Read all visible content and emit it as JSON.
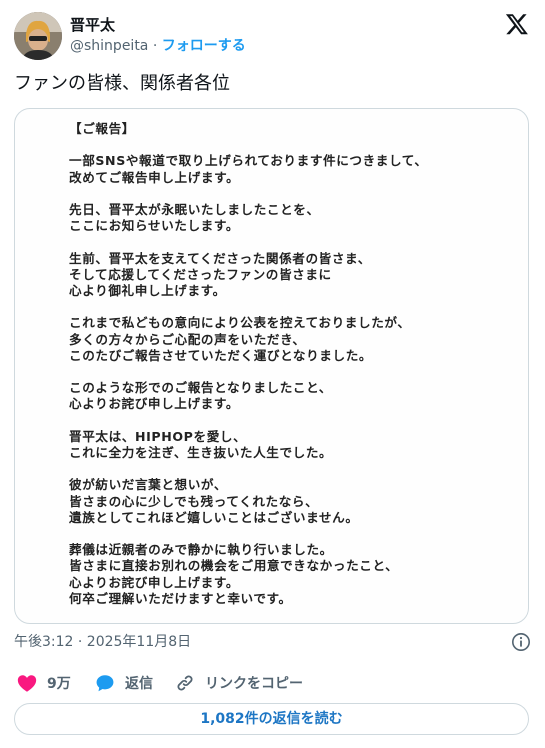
{
  "author": {
    "display_name": "晋平太",
    "handle": "@shinpeita",
    "separator": "·",
    "follow_label": "フォローする"
  },
  "tweet": {
    "text": "ファンの皆様、関係者各位",
    "timestamp": "午後3:12 · 2025年11月8日"
  },
  "document": {
    "paragraphs": [
      [
        "【ご報告】"
      ],
      [
        "一部SNSや報道で取り上げられております件につきまして、",
        "改めてご報告申し上げます。"
      ],
      [
        "先日、晋平太が永眠いたしましたことを、",
        "ここにお知らせいたします。"
      ],
      [
        "生前、晋平太を支えてくださった関係者の皆さま、",
        "そして応援してくださったファンの皆さまに",
        "心より御礼申し上げます。"
      ],
      [
        "これまで私どもの意向により公表を控えておりましたが、",
        "多くの方々からご心配の声をいただき、",
        "このたびご報告させていただく運びとなりました。"
      ],
      [
        "このような形でのご報告となりましたこと、",
        "心よりお詫び申し上げます。"
      ],
      [
        "晋平太は、HIPHOPを愛し、",
        "これに全力を注ぎ、生き抜いた人生でした。"
      ],
      [
        "彼が紡いだ言葉と想いが、",
        "皆さまの心に少しでも残ってくれたなら、",
        "遺族としてこれほど嬉しいことはございません。"
      ],
      [
        "葬儀は近親者のみで静かに執り行いました。",
        "皆さまに直接お別れの機会をご用意できなかったこと、",
        "心よりお詫び申し上げます。",
        "何卒ご理解いただけますと幸いです。"
      ]
    ]
  },
  "actions": {
    "like_count": "9万",
    "reply_label": "返信",
    "copy_link_label": "リンクをコピー"
  },
  "read_replies_label": "1,082件の返信を読む",
  "colors": {
    "accent": "#1d9bf0",
    "like": "#f91880",
    "muted": "#536471"
  }
}
